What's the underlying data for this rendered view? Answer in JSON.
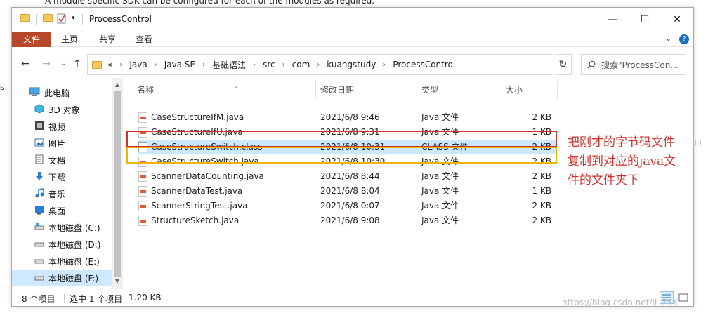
{
  "background": {
    "caption": "A module specific SDK can be configured for each of the modules as required.",
    "left_fragment": "s"
  },
  "window": {
    "title": "ProcessControl",
    "buttons": {
      "minimize": "—",
      "maximize": "☐",
      "close": "✕"
    }
  },
  "ribbon": {
    "tabs": [
      "文件",
      "主页",
      "共享",
      "查看"
    ],
    "expand": "⌄",
    "help": "?"
  },
  "address": {
    "overflow": "«",
    "crumbs": [
      "Java",
      "Java SE",
      "基础语法",
      "src",
      "com",
      "kuangstudy",
      "ProcessControl"
    ],
    "search_placeholder": "搜索\"ProcessCon..."
  },
  "nav": {
    "items": [
      {
        "label": "此电脑",
        "icon": "computer-icon"
      },
      {
        "label": "3D 对象",
        "icon": "cube-icon"
      },
      {
        "label": "视频",
        "icon": "video-icon"
      },
      {
        "label": "图片",
        "icon": "picture-icon"
      },
      {
        "label": "文档",
        "icon": "document-icon"
      },
      {
        "label": "下载",
        "icon": "download-icon"
      },
      {
        "label": "音乐",
        "icon": "music-icon"
      },
      {
        "label": "桌面",
        "icon": "desktop-icon"
      },
      {
        "label": "本地磁盘 (C:)",
        "icon": "drive-icon"
      },
      {
        "label": "本地磁盘 (D:)",
        "icon": "drive-icon"
      },
      {
        "label": "本地磁盘 (E:)",
        "icon": "drive-icon"
      },
      {
        "label": "本地磁盘 (F:)",
        "icon": "drive-icon"
      }
    ],
    "selected_index": 11
  },
  "files": {
    "columns": [
      "名称",
      "修改日期",
      "类型",
      "大小"
    ],
    "rows": [
      {
        "name": "CaseStructureIfM.java",
        "date": "2021/6/8 9:46",
        "type": "Java 文件",
        "size": "2 KB",
        "icon": "java-file-icon"
      },
      {
        "name": "CaseStructureIfU.java",
        "date": "2021/6/8 9:31",
        "type": "Java 文件",
        "size": "1 KB",
        "icon": "java-file-icon"
      },
      {
        "name": "CaseStructureSwitch.class",
        "date": "2021/6/8 10:31",
        "type": "CLASS 文件",
        "size": "2 KB",
        "icon": "class-file-icon"
      },
      {
        "name": "CaseStructureSwitch.java",
        "date": "2021/6/8 10:30",
        "type": "Java 文件",
        "size": "2 KB",
        "icon": "java-file-icon"
      },
      {
        "name": "ScannerDataCounting.java",
        "date": "2021/6/8 8:44",
        "type": "Java 文件",
        "size": "2 KB",
        "icon": "java-file-icon"
      },
      {
        "name": "ScannerDataTest.java",
        "date": "2021/6/8 8:04",
        "type": "Java 文件",
        "size": "1 KB",
        "icon": "java-file-icon"
      },
      {
        "name": "ScannerStringTest.java",
        "date": "2021/6/8 0:07",
        "type": "Java 文件",
        "size": "2 KB",
        "icon": "java-file-icon"
      },
      {
        "name": "StructureSketch.java",
        "date": "2021/6/8 9:08",
        "type": "Java 文件",
        "size": "2 KB",
        "icon": "java-file-icon"
      }
    ],
    "selected_index": 2
  },
  "status": {
    "count": "8 个项目",
    "selection": "选中 1 个项目",
    "size": "1.20 KB"
  },
  "annotation": {
    "lines": [
      "把刚才的字节码文件",
      "复制到对应的java文",
      "件的文件夹下"
    ],
    "color": "#d0312d"
  },
  "watermark": "https://blog.csdn.net/JI_ZSX",
  "colors": {
    "file_tab": "#b7472a",
    "selection": "#cce8ff",
    "red_box": "#d0312d",
    "yellow_box": "#f0b500"
  }
}
